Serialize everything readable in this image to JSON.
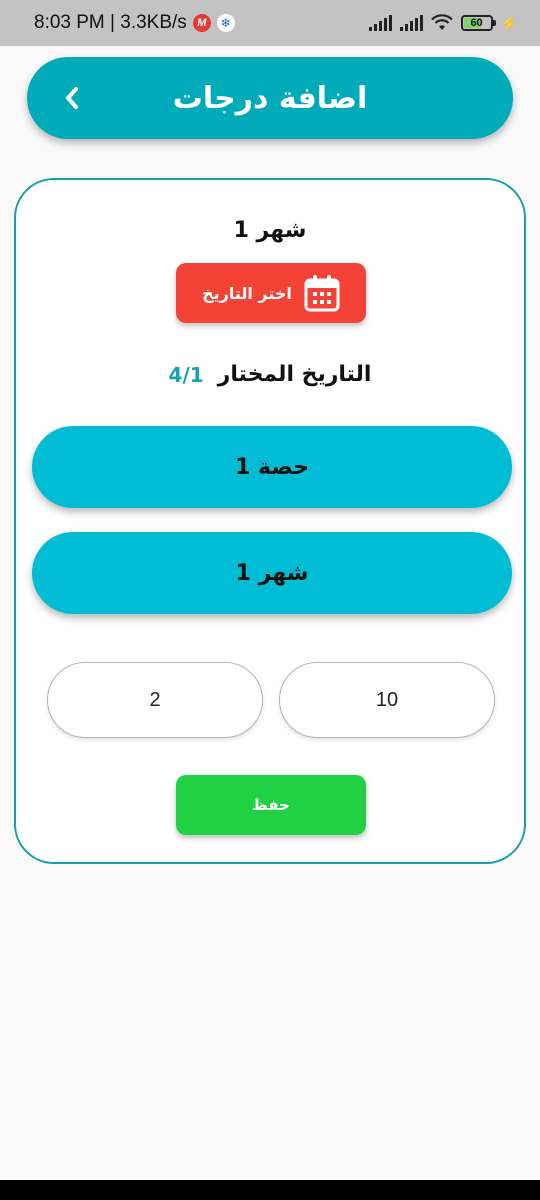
{
  "status_bar": {
    "time_speed": "8:03 PM | 3.3KB/s",
    "app_badge": "M",
    "snow_glyph": "❄",
    "battery": "60",
    "bolt": "⚡"
  },
  "header": {
    "title": "اضافة درجات",
    "back_icon": "chevron-left-icon"
  },
  "form": {
    "month_title": "شهر 1",
    "date_button_label": "اختر التاريخ",
    "date_button_icon": "calendar-icon",
    "selected_date_label": "التاريخ المختار",
    "selected_date_value": "4/1",
    "lesson_pill": "حصة 1",
    "month_pill": "شهر 1",
    "grade_left_value": "2",
    "grade_right_value": "10",
    "save_label": "حفظ"
  },
  "colors": {
    "header": "#00abb9",
    "pill": "#00bcd4",
    "date_button": "#f44336",
    "save_button": "#1fd143",
    "accent_text": "#17a2b0"
  }
}
